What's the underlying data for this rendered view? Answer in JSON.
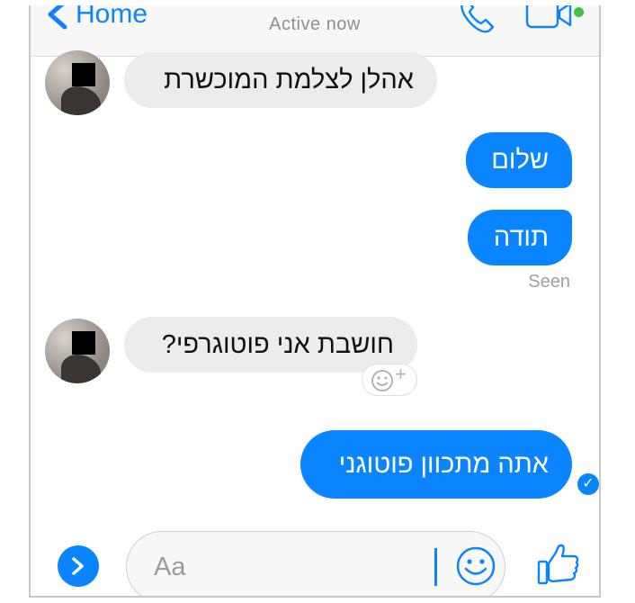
{
  "header": {
    "back_label": "Home",
    "status": "Active now",
    "accent": "#0a84ff",
    "online_color": "#41c341"
  },
  "messages": [
    {
      "direction": "incoming",
      "text": "אהלן לצלמת המוכשרת"
    },
    {
      "direction": "outgoing",
      "text": "שלום"
    },
    {
      "direction": "outgoing",
      "text": "תודה"
    },
    {
      "direction": "incoming",
      "text": "חושבת אני פוטוגרפי?"
    },
    {
      "direction": "outgoing",
      "text": "אתה מתכוון פוטוגני"
    }
  ],
  "seen_label": "Seen",
  "composer": {
    "placeholder": "Aa"
  },
  "icons": {
    "back": "chevron-left-icon",
    "call": "phone-icon",
    "video": "video-camera-icon",
    "react": "smiley-plus-icon",
    "delivered": "checkmark-circle-icon",
    "expand": "chevron-right-icon",
    "emoji": "smiley-icon",
    "like": "thumbs-up-icon"
  }
}
